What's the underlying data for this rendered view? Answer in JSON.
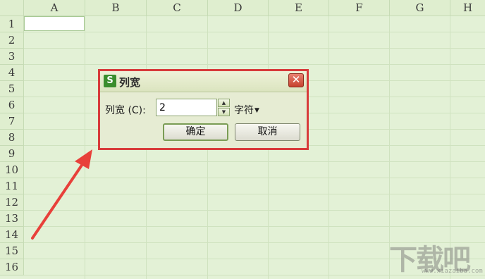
{
  "sheet": {
    "columns": [
      "A",
      "B",
      "C",
      "D",
      "E",
      "F",
      "G",
      "H"
    ],
    "rows": [
      "1",
      "2",
      "3",
      "4",
      "5",
      "6",
      "7",
      "8",
      "9",
      "10",
      "11",
      "12",
      "13",
      "14",
      "15",
      "16"
    ]
  },
  "dialog": {
    "title": "列宽",
    "app_logo": "S",
    "label": "列宽 (C):",
    "value": "2",
    "unit": "字符",
    "ok_label": "确定",
    "cancel_label": "取消",
    "close_glyph": "✕"
  },
  "watermark": {
    "text": "下载吧",
    "sub": "www.xiazaiba.com"
  },
  "colors": {
    "highlight": "#d83b3b",
    "app_brand": "#3a8d2d"
  }
}
